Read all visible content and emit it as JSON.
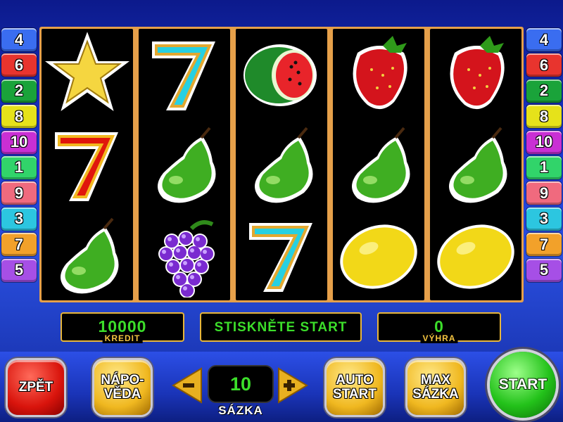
{
  "paylines": {
    "left": [
      {
        "num": "4",
        "color": "#3a6df0"
      },
      {
        "num": "6",
        "color": "#e8342e"
      },
      {
        "num": "2",
        "color": "#1aa33a"
      },
      {
        "num": "8",
        "color": "#e6e21a"
      },
      {
        "num": "10",
        "color": "#c92fd4"
      },
      {
        "num": "1",
        "color": "#31d46a"
      },
      {
        "num": "9",
        "color": "#f06a7e"
      },
      {
        "num": "3",
        "color": "#2cc6e0"
      },
      {
        "num": "7",
        "color": "#f2a12a"
      },
      {
        "num": "5",
        "color": "#a64fe6"
      }
    ],
    "right": [
      {
        "num": "4",
        "color": "#3a6df0"
      },
      {
        "num": "6",
        "color": "#e8342e"
      },
      {
        "num": "2",
        "color": "#1aa33a"
      },
      {
        "num": "8",
        "color": "#e6e21a"
      },
      {
        "num": "10",
        "color": "#c92fd4"
      },
      {
        "num": "1",
        "color": "#31d46a"
      },
      {
        "num": "9",
        "color": "#f06a7e"
      },
      {
        "num": "3",
        "color": "#2cc6e0"
      },
      {
        "num": "7",
        "color": "#f2a12a"
      },
      {
        "num": "5",
        "color": "#a64fe6"
      }
    ]
  },
  "reels": [
    [
      "star-icon",
      "red-seven-icon",
      "pear-icon"
    ],
    [
      "cyan-seven-icon",
      "pear-icon",
      "grapes-icon"
    ],
    [
      "watermelon-icon",
      "pear-icon",
      "cyan-seven-icon"
    ],
    [
      "strawberry-icon",
      "pear-icon",
      "lemon-icon"
    ],
    [
      "strawberry-icon",
      "pear-icon",
      "lemon-icon"
    ]
  ],
  "credit": {
    "value": "10000",
    "label": "KREDIT"
  },
  "message": {
    "text": "STISKNĚTE START"
  },
  "win": {
    "value": "0",
    "label": "VÝHRA"
  },
  "controls": {
    "back_label": "ZPĚT",
    "help_label_1": "NÁPO-",
    "help_label_2": "VĚDA",
    "bet_value": "10",
    "bet_label": "SÁZKA",
    "autostart_label_1": "AUTO",
    "autostart_label_2": "START",
    "maxbet_label_1": "MAX",
    "maxbet_label_2": "SÁZKA",
    "start_label": "START"
  },
  "colors": {
    "accent_green": "#3cde2a",
    "frame_gold": "#e8b63a",
    "bg_blue": "#1d3bd6"
  }
}
